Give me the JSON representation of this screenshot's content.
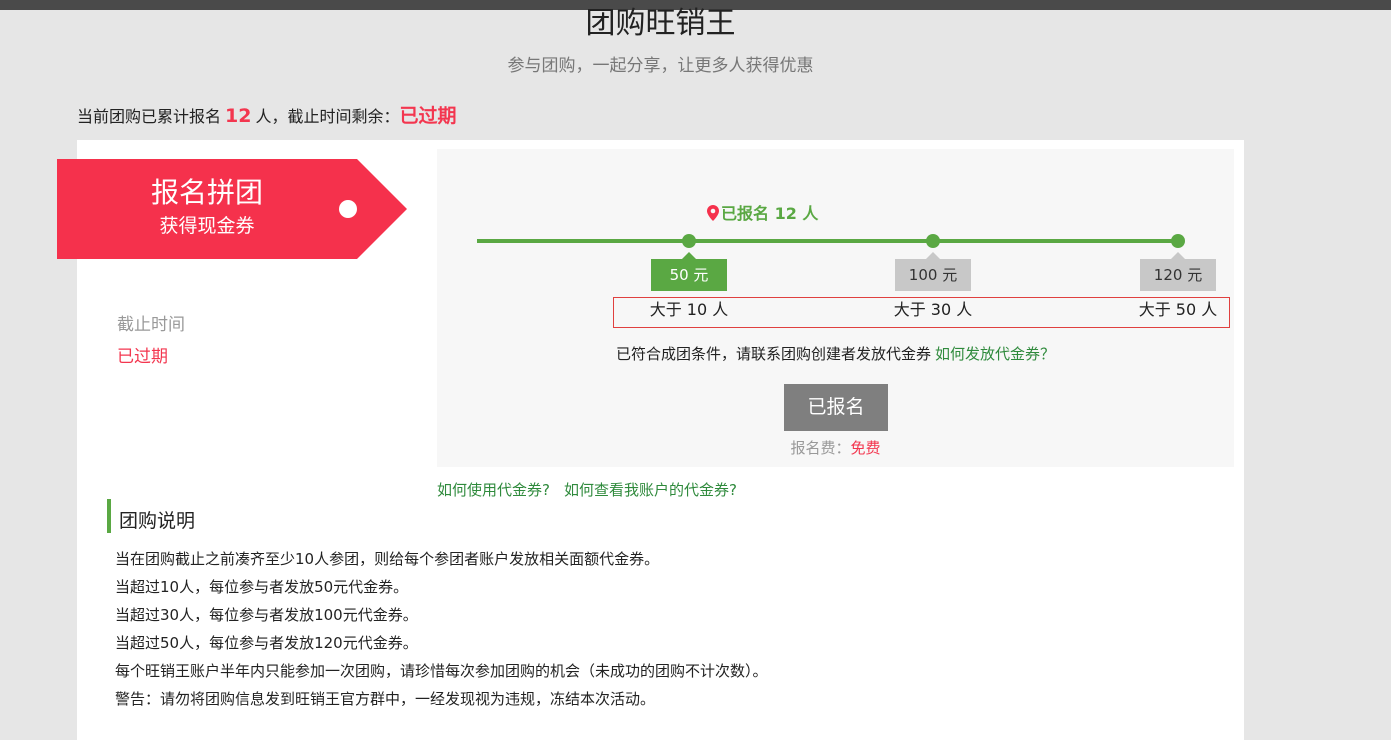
{
  "header": {
    "title": "团购旺销王",
    "subtitle": "参与团购，一起分享，让更多人获得优惠"
  },
  "status": {
    "prefix": "当前团购已累计报名",
    "count": "12",
    "middle": "人，截止时间剩余：",
    "remaining": "已过期"
  },
  "ribbon": {
    "title": "报名拼团",
    "subtitle": "获得现金券"
  },
  "deadline": {
    "label": "截止时间",
    "value": "已过期"
  },
  "progress": {
    "signed_label": "已报名 12 人",
    "pin_icon": "map-pin-icon",
    "tiers": [
      {
        "amount": "50 元",
        "condition": "大于 10 人",
        "reached": true
      },
      {
        "amount": "100 元",
        "condition": "大于 30 人",
        "reached": false
      },
      {
        "amount": "120 元",
        "condition": "大于 50 人",
        "reached": false
      }
    ],
    "notice": "已符合成团条件，请联系团购创建者发放代金券",
    "notice_link": "如何发放代金券？",
    "button_label": "已报名",
    "fee_label": "报名费：",
    "fee_value": "免费"
  },
  "help_links": {
    "use_voucher": "如何使用代金券?",
    "view_voucher": "如何查看我账户的代金券?"
  },
  "description": {
    "title": "团购说明",
    "lines": [
      "当在团购截止之前凑齐至少10人参团，则给每个参团者账户发放相关面额代金券。",
      "当超过10人，每位参与者发放50元代金券。",
      "当超过30人，每位参与者发放100元代金券。",
      "当超过50人，每位参与者发放120元代金券。",
      "每个旺销王账户半年内只能参加一次团购，请珍惜每次参加团购的机会（未成功的团购不计次数）。",
      "警告：请勿将团购信息发到旺销王官方群中，一经发现视为违规，冻结本次活动。"
    ]
  },
  "colors": {
    "accent_red": "#f5314c",
    "accent_green": "#5aa843",
    "link_green": "#2f8a3c",
    "button_gray": "#7f7f7f"
  }
}
